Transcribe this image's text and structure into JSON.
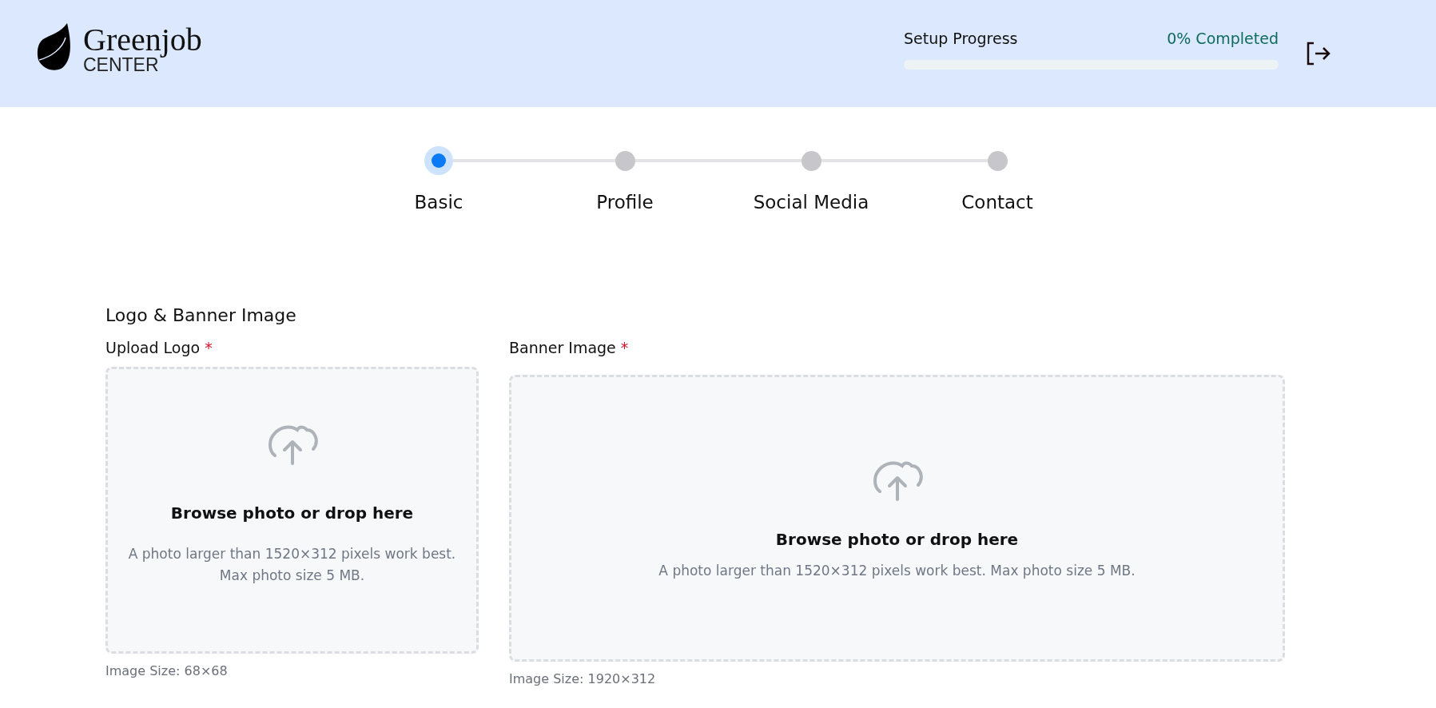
{
  "header": {
    "logo": {
      "name": "Greenjob",
      "subtitle": "CENTER"
    },
    "progress": {
      "label": "Setup Progress",
      "status": "0% Completed",
      "level": 0
    }
  },
  "steps": [
    {
      "label": "Basic",
      "selected": true
    },
    {
      "label": "Profile",
      "selected": false
    },
    {
      "label": "Social Media",
      "selected": false
    },
    {
      "label": "Contact",
      "selected": false
    }
  ],
  "section": {
    "title": "Logo & Banner Image",
    "uploads": [
      {
        "kind": "logo",
        "label": "Upload Logo",
        "required_mark": "*",
        "prompt": "Browse photo or drop here",
        "hint": "A photo larger than 1520×312 pixels work best. Max photo size 5 MB.",
        "size_note": "Image Size: 68×68"
      },
      {
        "kind": "banner",
        "label": "Banner Image",
        "required_mark": "*",
        "prompt": "Browse photo or drop here",
        "hint": "A photo larger than 1520×312 pixels work best. Max photo size 5 MB.",
        "size_note": "Image Size: 1920×312"
      }
    ]
  }
}
